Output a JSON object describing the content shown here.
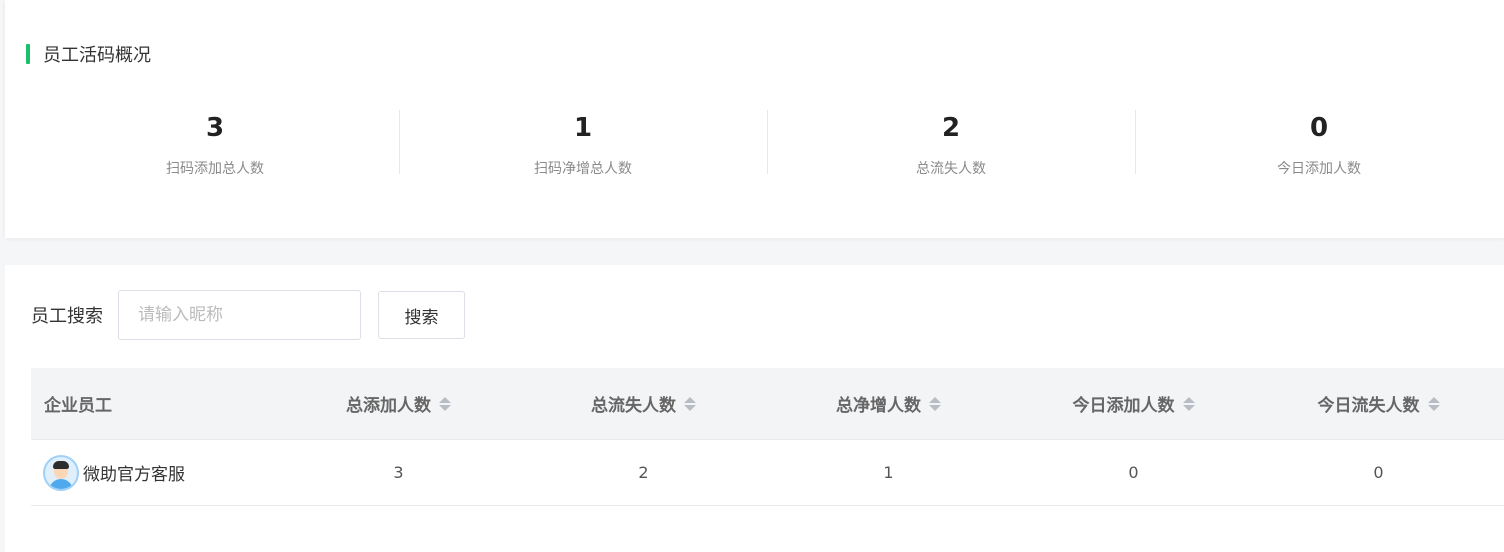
{
  "overview": {
    "title": "员工活码概况",
    "stats": [
      {
        "value": "3",
        "label": "扫码添加总人数"
      },
      {
        "value": "1",
        "label": "扫码净增总人数"
      },
      {
        "value": "2",
        "label": "总流失人数"
      },
      {
        "value": "0",
        "label": "今日添加人数"
      }
    ]
  },
  "search": {
    "label": "员工搜索",
    "placeholder": "请输入昵称",
    "button_label": "搜索"
  },
  "table": {
    "columns": [
      "企业员工",
      "总添加人数",
      "总流失人数",
      "总净增人数",
      "今日添加人数",
      "今日流失人数"
    ],
    "rows": [
      {
        "name": "微助官方客服",
        "total_added": "3",
        "total_lost": "2",
        "net_growth": "1",
        "today_added": "0",
        "today_lost": "0"
      }
    ]
  },
  "colors": {
    "accent": "#1bc16a"
  }
}
